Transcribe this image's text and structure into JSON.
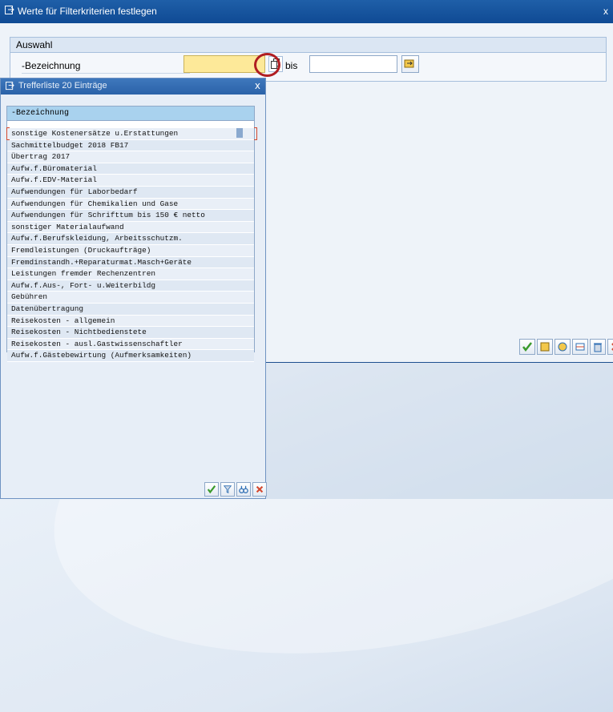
{
  "main_dialog": {
    "title": "Werte für Filterkriterien festlegen",
    "close_symbol": "x",
    "group": {
      "header": "Auswahl",
      "field_label": "-Bezeichnung",
      "from_value": "",
      "to_label": "bis",
      "to_value": ""
    },
    "toolbar": [
      "check-icon",
      "new-entries-icon",
      "select-icon",
      "delete-row-icon",
      "trash-icon",
      "cancel-icon"
    ]
  },
  "hit_list_popup": {
    "title": "Trefferliste 20 Einträge",
    "close_symbol": "x",
    "column_header": "-Bezeichnung",
    "rows": [
      "sonstige Kostenersätze u.Erstattungen",
      "Sachmittelbudget 2018 FB17",
      "Übertrag 2017",
      "Aufw.f.Büromaterial",
      "Aufw.f.EDV-Material",
      "Aufwendungen für Laborbedarf",
      "Aufwendungen für Chemikalien und Gase",
      "Aufwendungen für Schrifttum bis 150 € netto",
      "sonstiger Materialaufwand",
      "Aufw.f.Berufskleidung, Arbeitsschutzm.",
      "Fremdleistungen (Druckaufträge)",
      "Fremdinstandh.+Reparaturmat.Masch+Geräte",
      "Leistungen fremder Rechenzentren",
      "Aufw.f.Aus-, Fort- u.Weiterbildg",
      "Gebühren",
      "Datenübertragung",
      "Reisekosten - allgemein",
      "Reisekosten - Nichtbedienstete",
      "Reisekosten - ausl.Gastwissenschaftler",
      "Aufw.f.Gästebewirtung (Aufmerksamkeiten)"
    ],
    "toolbar": [
      "check-icon",
      "filter-icon",
      "find-icon",
      "cancel-icon"
    ]
  },
  "colors": {
    "title_bar": "#0f4a94",
    "input_required": "#fde999",
    "highlight_circle": "#b01e22",
    "column_header": "#a9d2ee"
  }
}
